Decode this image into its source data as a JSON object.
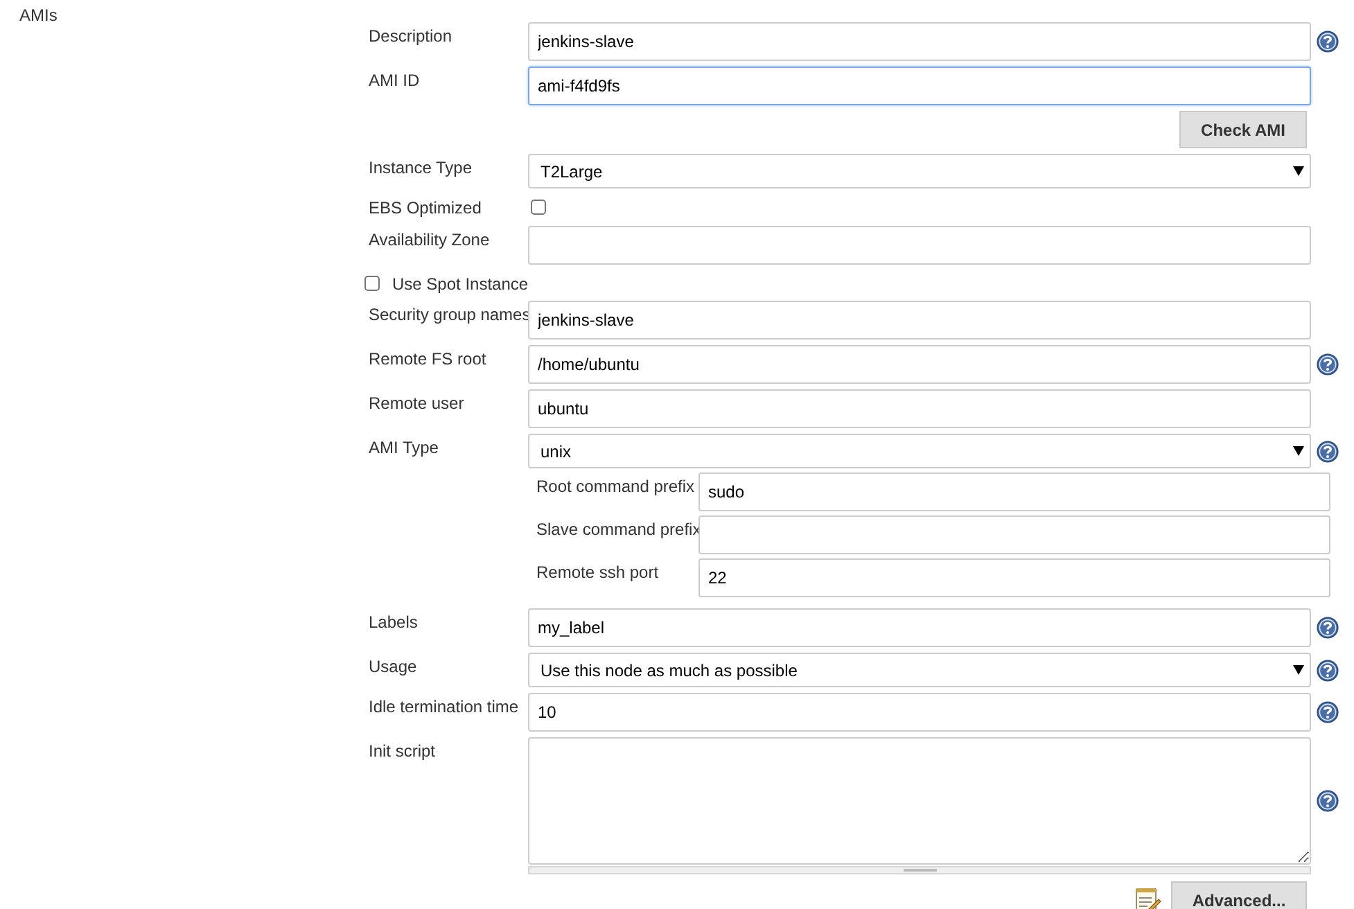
{
  "section_label": "AMIs",
  "rows": [
    {
      "kind": "text",
      "label": "Description",
      "value": "jenkins-slave",
      "focused": false,
      "help": true
    },
    {
      "kind": "text",
      "label": "AMI ID",
      "value": "ami-f4fd9fs",
      "focused": true,
      "help": false
    },
    {
      "kind": "button",
      "label": "Check AMI"
    },
    {
      "kind": "select",
      "label": "Instance Type",
      "value": "T2Large",
      "help": false
    },
    {
      "kind": "checkbox",
      "label": "EBS Optimized",
      "checked": false
    },
    {
      "kind": "text",
      "label": "Availability Zone",
      "focused": false,
      "help": false
    },
    {
      "kind": "option",
      "label": "Use Spot Instance",
      "checked": false
    },
    {
      "kind": "text",
      "label": "Security group names",
      "value": "jenkins-slave",
      "focused": false,
      "help": false
    },
    {
      "kind": "text",
      "label": "Remote FS root",
      "value": "/home/ubuntu",
      "focused": false,
      "help": true
    },
    {
      "kind": "text",
      "label": "Remote user",
      "value": "ubuntu",
      "focused": false,
      "help": false
    },
    {
      "kind": "select",
      "label": "AMI Type",
      "value": "unix",
      "help": true
    },
    {
      "kind": "nested",
      "children": [
        {
          "label": "Root command prefix",
          "value": "sudo"
        },
        {
          "label": "Slave command prefix"
        },
        {
          "label": "Remote ssh port",
          "value": "22"
        }
      ]
    },
    {
      "kind": "text",
      "label": "Labels",
      "value": "my_label",
      "focused": false,
      "help": true
    },
    {
      "kind": "select",
      "label": "Usage",
      "value": "Use this node as much as possible",
      "help": true
    },
    {
      "kind": "text",
      "label": "Idle termination time",
      "value": "10",
      "focused": false,
      "help": true
    },
    {
      "kind": "textarea",
      "label": "Init script",
      "help": true
    }
  ],
  "advanced_button": "Advanced..."
}
